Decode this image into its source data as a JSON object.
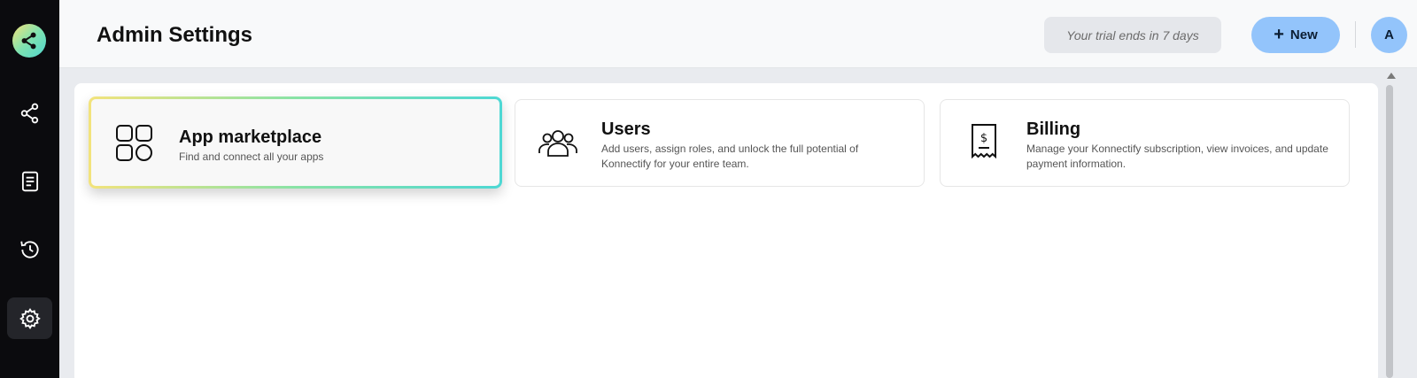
{
  "app": {
    "name": "Konnectify"
  },
  "sidebar": {
    "logo_icon": "share-logo-icon",
    "items": [
      {
        "name": "flows",
        "icon": "share-icon",
        "active": false
      },
      {
        "name": "documents",
        "icon": "document-icon",
        "active": false
      },
      {
        "name": "history",
        "icon": "history-icon",
        "active": false
      },
      {
        "name": "settings",
        "icon": "gear-icon",
        "active": true
      }
    ]
  },
  "header": {
    "title": "Admin Settings",
    "trial_text": "Your trial ends in 7 days",
    "new_button_label": "New",
    "avatar_initial": "A"
  },
  "cards": [
    {
      "title": "App marketplace",
      "description": "Find and connect all your apps",
      "icon": "apps-grid-icon"
    },
    {
      "title": "Users",
      "description": "Add users, assign roles, and unlock the full potential of Konnectify for your entire team.",
      "icon": "users-group-icon"
    },
    {
      "title": "Billing",
      "description": "Manage your Konnectify subscription, view invoices, and update payment information.",
      "icon": "receipt-icon"
    }
  ],
  "colors": {
    "sidebar_bg": "#0b0b0e",
    "accent_blue": "#93c4fb",
    "gradient_start": "#f3e37c",
    "gradient_end": "#4dd8d4"
  }
}
